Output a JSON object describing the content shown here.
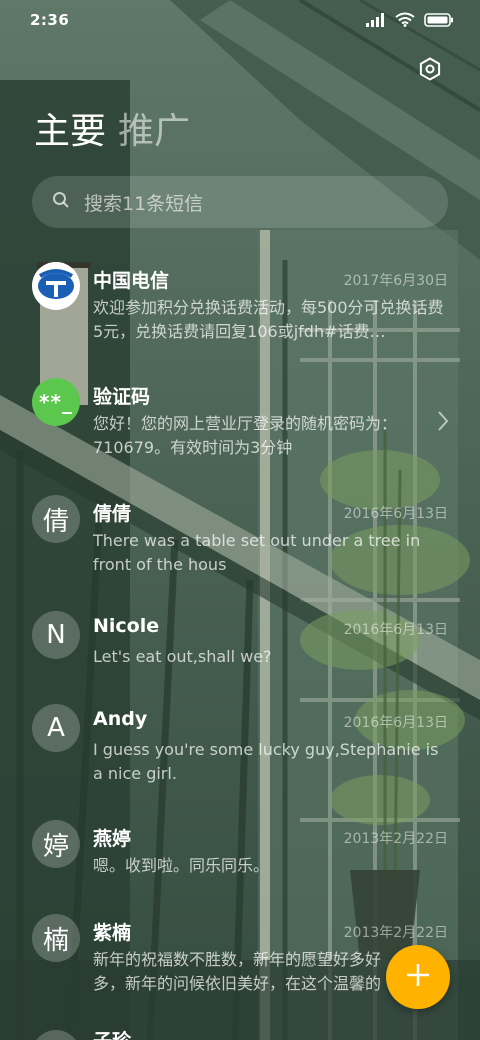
{
  "status_bar": {
    "time": "2:36",
    "icons": [
      "signal-icon",
      "wifi-icon",
      "battery-icon"
    ]
  },
  "header": {
    "tabs": [
      {
        "label": "主要",
        "active": true
      },
      {
        "label": "推广",
        "active": false
      }
    ],
    "settings_icon": "gear-icon"
  },
  "search": {
    "placeholder": "搜索11条短信",
    "icon": "search-icon"
  },
  "messages": [
    {
      "name": "中国电信",
      "avatar_type": "logo",
      "avatar_text": "",
      "date": "2017年6月30日",
      "preview": "欢迎参加积分兑换话费活动，每500分可兑换话费5元，兑换话费请回复106或jfdh#话费…"
    },
    {
      "name": "验证码",
      "avatar_type": "code",
      "avatar_text": "**_",
      "date": "",
      "preview": "您好！您的网上营业厅登录的随机密码为：710679。有效时间为3分钟"
    },
    {
      "name": "倩倩",
      "avatar_type": "letter",
      "avatar_text": "倩",
      "date": "2016年6月13日",
      "preview": "There was a table set out under a tree in front of the hous"
    },
    {
      "name": "Nicole",
      "avatar_type": "letter",
      "avatar_text": "N",
      "date": "2016年6月13日",
      "preview": "Let's eat out,shall we?"
    },
    {
      "name": "Andy",
      "avatar_type": "letter",
      "avatar_text": "A",
      "date": "2016年6月13日",
      "preview": "I guess you're some lucky guy,Stephanie is a nice girl."
    },
    {
      "name": "燕婷",
      "avatar_type": "letter",
      "avatar_text": "婷",
      "date": "2013年2月22日",
      "preview": "嗯。收到啦。同乐同乐。"
    },
    {
      "name": "紫楠",
      "avatar_type": "letter",
      "avatar_text": "楠",
      "date": "2013年2月22日",
      "preview": "新年的祝福数不胜数，新年的愿望好多好多，新年的问候依旧美好，在这个温馨的时刻"
    },
    {
      "name": "子珍",
      "avatar_type": "letter",
      "avatar_text": "",
      "date": "",
      "preview": ""
    }
  ],
  "fab": {
    "icon": "plus-icon",
    "color": "#ffb300"
  },
  "colors": {
    "code_avatar": "#5cc74d",
    "telecom_blue": "#1a5fb4",
    "fab": "#ffb300"
  }
}
